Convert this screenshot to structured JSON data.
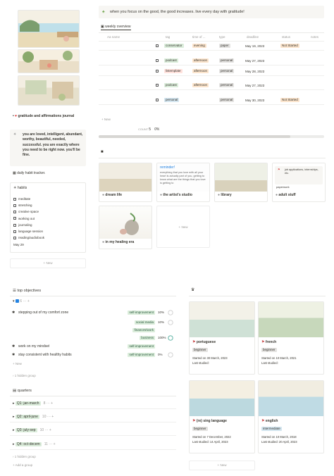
{
  "colors": {
    "orange": "#fbe4cc",
    "green": "#dbeddb",
    "red": "#ffe2dd",
    "blue": "#d3e5ef",
    "grey": "#e3e2e0",
    "bar": "#d7d6d3"
  },
  "banner": {
    "text": "when you focus on the good, the good increases. live every day with gratitude!"
  },
  "journal": {
    "title": "gratitude and affirmations journal",
    "affirmation": "you are loved, intelligent, abundant, worthy, beautiful, needed, successful. you are exactly where you need to be right now. you'll be fine."
  },
  "tracker": {
    "title": "daily habit tracker.",
    "habits_title": "habits",
    "items": [
      "meditate",
      "stretching",
      "creative space",
      "working out",
      "journaling",
      "language session",
      "reading/audiobook"
    ],
    "date": "May 29",
    "new": "New"
  },
  "weekly": {
    "title": "weekly overview",
    "headers": [
      "Aa name",
      "tag",
      "time of ...",
      "type",
      "deadline",
      "status",
      "notes"
    ],
    "rows": [
      {
        "tag": "conservator",
        "tagc": "green",
        "time": "evening",
        "type": "paper",
        "deadline": "May 19, 2023",
        "status": "Not Started"
      },
      {
        "tag": "podcast",
        "tagc": "green",
        "time": "afternoon",
        "type": "personal",
        "deadline": "May 27, 2023",
        "status": ""
      },
      {
        "tag": "listemplate",
        "tagc": "red",
        "time": "afternoon",
        "type": "personal",
        "deadline": "May 28, 2023",
        "status": ""
      },
      {
        "tag": "podcast",
        "tagc": "green",
        "time": "afternoon",
        "type": "personal",
        "deadline": "May 27, 2023",
        "status": ""
      },
      {
        "tag": "personal",
        "tagc": "blue",
        "time": "",
        "type": "personal",
        "deadline": "May 30, 2023",
        "status": "Not Started"
      }
    ],
    "new": "New",
    "count_label": "COUNT",
    "count": "5",
    "percent": "0%"
  },
  "gallery": {
    "cards": [
      "dream life",
      "the artist's studio",
      "library",
      "adult stuff",
      "in my healing era"
    ],
    "reminder_title": "reminder!",
    "reminder_text": "everything that you love with all your heart is actually part of you, getting to know what are the things that you love is getting to",
    "adult_text": "job applications, internships, etc.",
    "adult_sub": "paperwork",
    "new": "New"
  },
  "objectives": {
    "title": "top objectives",
    "group_count": "6",
    "items": [
      {
        "text": "stepping out of my comfort zone",
        "tag": "self-improvement",
        "pct": "10%",
        "star": true
      },
      {
        "text": "",
        "tag": "social media",
        "pct": "10%",
        "star": false
      },
      {
        "text": "",
        "tag": "finances/work",
        "pct": "",
        "star": false
      },
      {
        "text": "",
        "tag": "business",
        "pct": "100%",
        "star": false
      },
      {
        "text": "work on my mindset",
        "tag": "self-improvement",
        "pct": "",
        "star": true
      },
      {
        "text": "stay consistent with healthy habits",
        "tag": "self-improvement",
        "pct": "0%",
        "star": true
      }
    ],
    "new": "New",
    "hidden": "1 hidden group"
  },
  "quarters": {
    "title": "quarters",
    "items": [
      {
        "label": "Q1: jan-march",
        "count": "8"
      },
      {
        "label": "Q2: april-june",
        "count": "10"
      },
      {
        "label": "Q3: july-sep",
        "count": "10"
      },
      {
        "label": "Q4: oct-decem",
        "count": "11"
      }
    ],
    "hidden": "1 hidden group",
    "add": "Add a group"
  },
  "languages": {
    "cards": [
      {
        "name": "portuguese",
        "level": "beginner",
        "started": "Started on 30 March, 2023",
        "last": "Last studied:"
      },
      {
        "name": "french",
        "level": "beginner",
        "started": "Started on 10 March, 2021",
        "last": "Last studied:"
      },
      {
        "name": "(re) sing language",
        "level": "beginner",
        "started": "Started on 7 December, 2022",
        "last": "Last studied: 14 April, 2023"
      },
      {
        "name": "english",
        "level": "intermediate",
        "started": "Started on 10 March, 2018",
        "last": "Last studied: 20 April, 2023"
      }
    ],
    "new": "New"
  }
}
